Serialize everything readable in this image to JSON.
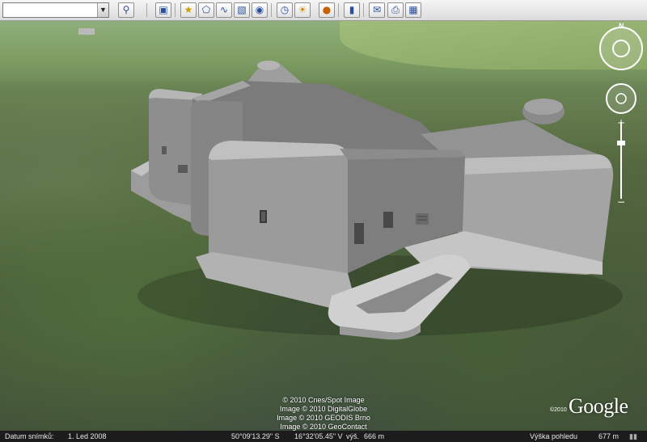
{
  "toolbar": {
    "search_value": "",
    "buttons": [
      {
        "name": "search-button",
        "glyph": "🔍"
      },
      {
        "name": "sidebar-toggle-button",
        "glyph": "▣"
      },
      {
        "name": "add-placemark-button",
        "glyph": "★"
      },
      {
        "name": "add-polygon-button",
        "glyph": "⬠"
      },
      {
        "name": "add-path-button",
        "glyph": "〰"
      },
      {
        "name": "add-overlay-button",
        "glyph": "▧"
      },
      {
        "name": "record-tour-button",
        "glyph": "◉"
      },
      {
        "name": "historical-imagery-button",
        "glyph": "◷"
      },
      {
        "name": "sunlight-button",
        "glyph": "☀"
      },
      {
        "name": "planets-button",
        "glyph": "🪐"
      },
      {
        "name": "ruler-button",
        "glyph": "▮"
      },
      {
        "name": "email-button",
        "glyph": "✉"
      },
      {
        "name": "print-button",
        "glyph": "⎙"
      },
      {
        "name": "view-in-maps-button",
        "glyph": "▦"
      }
    ]
  },
  "navigation": {
    "north_label": "N"
  },
  "attribution": {
    "lines": [
      "© 2010 Cnes/Spot Image",
      "Image © 2010 DigitalGlobe",
      "Image © 2010 GEODIS Brno",
      "Image © 2010 GeoContact"
    ],
    "logo_copyright": "©2010",
    "logo": "Google"
  },
  "statusbar": {
    "image_date_label": "Datum snímků:",
    "image_date": "1. Led 2008",
    "latitude": "50°09'13.29\" S",
    "longitude": "16°32'05.45\" V",
    "elevation_label": "výš.",
    "elevation": "666 m",
    "eye_alt_label": "Výška pohledu",
    "eye_alt": "677 m"
  },
  "colors": {
    "status_bg": "#1c1c1c",
    "bunker_gray": "#8a8a8a"
  }
}
